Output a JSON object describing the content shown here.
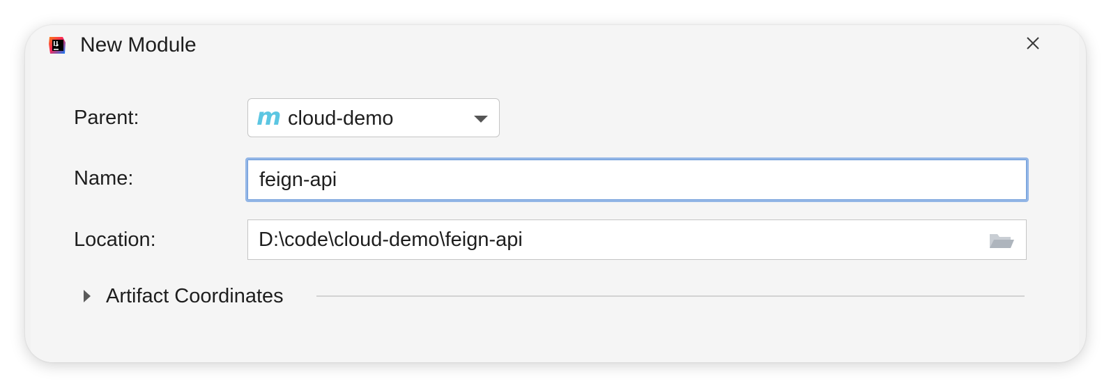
{
  "window": {
    "title": "New Module",
    "app_icon": "intellij-idea-icon",
    "close_icon": "close-icon"
  },
  "form": {
    "parent": {
      "label": "Parent:",
      "value": "cloud-demo",
      "icon": "maven-module-icon",
      "icon_glyph": "m",
      "icon_color": "#5cc6e2"
    },
    "name": {
      "label": "Name:",
      "value": "feign-api"
    },
    "location": {
      "label": "Location:",
      "value": "D:\\code\\cloud-demo\\feign-api",
      "browse_icon": "folder-open-icon"
    },
    "artifact_coordinates": {
      "label": "Artifact Coordinates",
      "expanded": false
    }
  },
  "colors": {
    "dialog_background": "#f5f5f5",
    "focus_border": "#93b6e6"
  }
}
